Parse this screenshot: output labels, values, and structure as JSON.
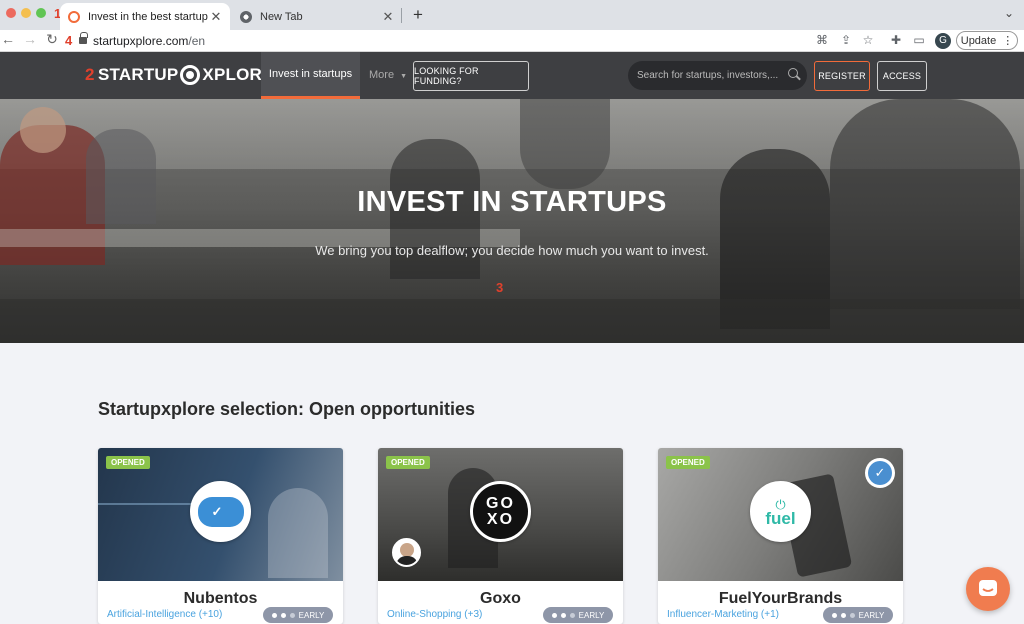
{
  "browser": {
    "markers": {
      "tab": "1",
      "logo": "2",
      "hero": "3",
      "url": "4"
    },
    "tabs": [
      {
        "title": "Invest in the best startups with",
        "active": true
      },
      {
        "title": "New Tab",
        "active": false
      }
    ],
    "new_tab": "+",
    "close_glyph": "✕",
    "url_host": "startupxplore.com",
    "url_path": "/en",
    "profile_initial": "G",
    "update_label": "Update"
  },
  "site": {
    "logo_pre": "STARTUP",
    "logo_post": "XPLORE",
    "nav": {
      "invest": "Invest in startups",
      "more": "More",
      "funding": "LOOKING FOR FUNDING?"
    },
    "search": {
      "placeholder": "Search for startups, investors,..."
    },
    "register": "REGISTER",
    "access": "ACCESS",
    "accent_color": "#f26b3a"
  },
  "hero": {
    "title": "INVEST IN STARTUPS",
    "subtitle": "We bring you top dealflow; you decide how much you want to invest."
  },
  "selection": {
    "title": "Startupxplore selection: Open opportunities",
    "cards": [
      {
        "badge": "OPENED",
        "name": "Nubentos",
        "category": "Artificial-Intelligence (+10)",
        "stage": "EARLY"
      },
      {
        "badge": "OPENED",
        "name": "Goxo",
        "category": "Online-Shopping (+3)",
        "stage": "EARLY",
        "logo_text_top": "GO",
        "logo_text_bottom": "XO"
      },
      {
        "badge": "OPENED",
        "name": "FuelYourBrands",
        "category": "Influencer-Marketing (+1)",
        "stage": "EARLY",
        "logo_text": "fuel"
      }
    ]
  }
}
